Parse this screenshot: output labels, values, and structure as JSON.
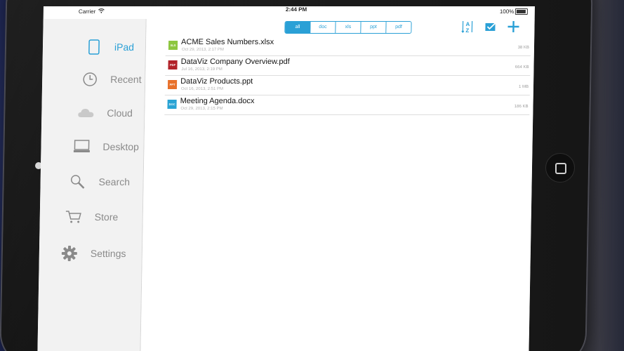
{
  "status_bar": {
    "carrier": "Carrier",
    "time": "2:44 PM",
    "battery": "100%"
  },
  "sidebar": {
    "items": [
      {
        "label": "iPad",
        "icon": "ipad-icon"
      },
      {
        "label": "Recent",
        "icon": "clock-icon"
      },
      {
        "label": "Cloud",
        "icon": "cloud-icon"
      },
      {
        "label": "Desktop",
        "icon": "desktop-icon"
      },
      {
        "label": "Search",
        "icon": "search-icon"
      },
      {
        "label": "Store",
        "icon": "cart-icon"
      },
      {
        "label": "Settings",
        "icon": "gear-icon"
      }
    ],
    "active": "iPad"
  },
  "filters": {
    "options": [
      "all",
      "doc",
      "xls",
      "ppt",
      "pdf"
    ],
    "selected": "all"
  },
  "toolbar": {
    "sort_icon": "sort-az-icon",
    "select_icon": "select-check-icon",
    "add_icon": "plus-icon"
  },
  "files": [
    {
      "name": "ACME Sales Numbers.xlsx",
      "date": "Oct 29, 2013, 2:17 PM",
      "size": "38 KB",
      "type": "XLS",
      "color": "#8dc63f"
    },
    {
      "name": "DataViz Company Overview.pdf",
      "date": "Jul 16, 2013, 2:19 PM",
      "size": "664 KB",
      "type": "PDF",
      "color": "#b2232a"
    },
    {
      "name": "DataViz Products.ppt",
      "date": "Oct 16, 2013, 2:51 PM",
      "size": "1 MB",
      "type": "PPT",
      "color": "#e8702a"
    },
    {
      "name": "Meeting Agenda.docx",
      "date": "Oct 29, 2013, 2:15 PM",
      "size": "186 KB",
      "type": "DOC",
      "color": "#29a3d4"
    }
  ],
  "colors": {
    "accent": "#2aa0d6",
    "sidebar_bg": "#f2f2f2"
  }
}
